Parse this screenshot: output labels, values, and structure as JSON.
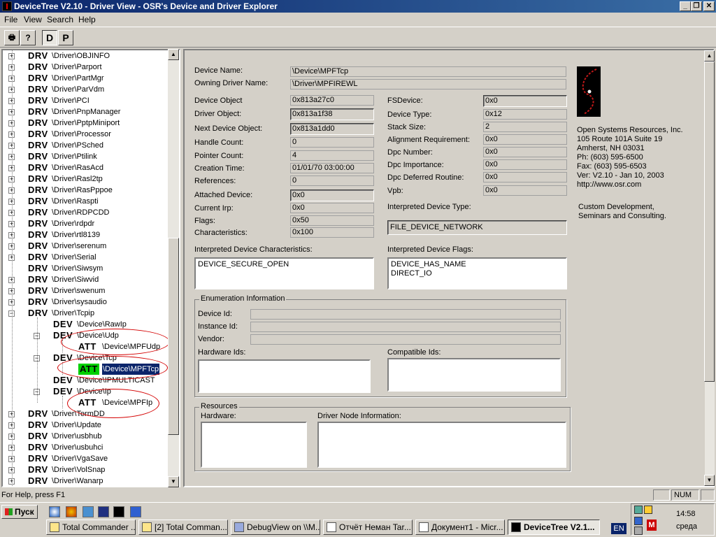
{
  "window": {
    "title": "DeviceTree V2.10 - Driver View - OSR's Device and Driver Explorer"
  },
  "menu": [
    "File",
    "View",
    "Search",
    "Help"
  ],
  "toolbar": {
    "d_label": "D",
    "p_label": "P"
  },
  "tree": [
    {
      "kind": "DRV",
      "path": "\\Driver\\OBJINFO"
    },
    {
      "kind": "DRV",
      "path": "\\Driver\\Parport"
    },
    {
      "kind": "DRV",
      "path": "\\Driver\\PartMgr"
    },
    {
      "kind": "DRV",
      "path": "\\Driver\\ParVdm"
    },
    {
      "kind": "DRV",
      "path": "\\Driver\\PCI"
    },
    {
      "kind": "DRV",
      "path": "\\Driver\\PnpManager"
    },
    {
      "kind": "DRV",
      "path": "\\Driver\\PptpMiniport"
    },
    {
      "kind": "DRV",
      "path": "\\Driver\\Processor"
    },
    {
      "kind": "DRV",
      "path": "\\Driver\\PSched"
    },
    {
      "kind": "DRV",
      "path": "\\Driver\\Ptilink"
    },
    {
      "kind": "DRV",
      "path": "\\Driver\\RasAcd"
    },
    {
      "kind": "DRV",
      "path": "\\Driver\\Rasl2tp"
    },
    {
      "kind": "DRV",
      "path": "\\Driver\\RasPppoe"
    },
    {
      "kind": "DRV",
      "path": "\\Driver\\Raspti"
    },
    {
      "kind": "DRV",
      "path": "\\Driver\\RDPCDD"
    },
    {
      "kind": "DRV",
      "path": "\\Driver\\rdpdr"
    },
    {
      "kind": "DRV",
      "path": "\\Driver\\rtl8139"
    },
    {
      "kind": "DRV",
      "path": "\\Driver\\serenum"
    },
    {
      "kind": "DRV",
      "path": "\\Driver\\Serial"
    },
    {
      "kind": "DRV",
      "path": "\\Driver\\Siwsym"
    },
    {
      "kind": "DRV",
      "path": "\\Driver\\Siwvid"
    },
    {
      "kind": "DRV",
      "path": "\\Driver\\swenum"
    },
    {
      "kind": "DRV",
      "path": "\\Driver\\sysaudio"
    },
    {
      "kind": "DRV",
      "path": "\\Driver\\Tcpip"
    },
    {
      "kind": "DEV",
      "path": "\\Device\\RawIp"
    },
    {
      "kind": "DEV",
      "path": "\\Device\\Udp"
    },
    {
      "kind": "ATT",
      "path": "\\Device\\MPFUdp"
    },
    {
      "kind": "DEV",
      "path": "\\Device\\Tcp"
    },
    {
      "kind": "ATT",
      "path": "\\Device\\MPFTcp"
    },
    {
      "kind": "DEV",
      "path": "\\Device\\IPMULTICAST"
    },
    {
      "kind": "DEV",
      "path": "\\Device\\Ip"
    },
    {
      "kind": "ATT",
      "path": "\\Device\\MPFIp"
    },
    {
      "kind": "DRV",
      "path": "\\Driver\\TermDD"
    },
    {
      "kind": "DRV",
      "path": "\\Driver\\Update"
    },
    {
      "kind": "DRV",
      "path": "\\Driver\\usbhub"
    },
    {
      "kind": "DRV",
      "path": "\\Driver\\usbuhci"
    },
    {
      "kind": "DRV",
      "path": "\\Driver\\VgaSave"
    },
    {
      "kind": "DRV",
      "path": "\\Driver\\VolSnap"
    },
    {
      "kind": "DRV",
      "path": "\\Driver\\Wanarp"
    }
  ],
  "detail": {
    "device_name_label": "Device Name:",
    "device_name": "\\Device\\MPFTcp",
    "owning_driver_label": "Owning Driver Name:",
    "owning_driver": "\\Driver\\MPFIREWL",
    "left_fields": [
      {
        "label": "Device Object",
        "value": "0x813a27c0"
      },
      {
        "label": "Driver Object:",
        "value": "0x813a1f38"
      },
      {
        "label": "Next Device Object:",
        "value": "0x813a1dd0"
      },
      {
        "label": "Handle Count:",
        "value": "0"
      },
      {
        "label": "Pointer Count:",
        "value": "4"
      },
      {
        "label": "Creation Time:",
        "value": "01/01/70 03:00:00"
      },
      {
        "label": "References:",
        "value": "0"
      },
      {
        "label": "Attached Device:",
        "value": "0x0"
      },
      {
        "label": "Current Irp:",
        "value": "0x0"
      },
      {
        "label": "Flags:",
        "value": "0x50"
      },
      {
        "label": "Characteristics:",
        "value": "0x100"
      }
    ],
    "right_fields": [
      {
        "label": "FSDevice:",
        "value": "0x0"
      },
      {
        "label": "Device Type:",
        "value": "0x12"
      },
      {
        "label": "Stack Size:",
        "value": "2"
      },
      {
        "label": "Alignment Requirement:",
        "value": "0x0"
      },
      {
        "label": "Dpc Number:",
        "value": "0x0"
      },
      {
        "label": "Dpc Importance:",
        "value": "0x0"
      },
      {
        "label": "Dpc Deferred Routine:",
        "value": "0x0"
      },
      {
        "label": "Vpb:",
        "value": "0x0"
      }
    ],
    "interp_type_label": "Interpreted Device Type:",
    "interp_type": "FILE_DEVICE_NETWORK",
    "interp_chars_label": "Interpreted Device Characteristics:",
    "interp_chars": "DEVICE_SECURE_OPEN",
    "interp_flags_label": "Interpreted Device Flags:",
    "interp_flags": [
      "DEVICE_HAS_NAME",
      "DIRECT_IO"
    ],
    "enum_group": "Enumeration Information",
    "device_id_label": "Device Id:",
    "instance_id_label": "Instance Id:",
    "vendor_label": "Vendor:",
    "hardware_ids_label": "Hardware Ids:",
    "compatible_ids_label": "Compatible Ids:",
    "resources_group": "Resources",
    "hardware_label": "Hardware:",
    "driver_node_label": "Driver Node Information:",
    "company": [
      "Open Systems Resources, Inc.",
      "105 Route 101A Suite 19",
      "Amherst, NH 03031",
      "Ph:  (603) 595-6500",
      "Fax: (603) 595-6503",
      "Ver: V2.10 - Jan 10, 2003",
      "http://www.osr.com"
    ],
    "services": [
      "Custom Development,",
      "Seminars and Consulting."
    ]
  },
  "status": {
    "help": "For Help, press F1",
    "num": "NUM"
  },
  "taskbar": {
    "start": "Пуск",
    "tasks": [
      "Total Commander ...",
      "[2] Total Comman...",
      "DebugView on \\\\M...",
      "Отчёт Неман Tar...",
      "Документ1 - Micr...",
      "DeviceTree V2.1..."
    ],
    "lang": "EN",
    "time": "14:58",
    "day": "среда"
  }
}
